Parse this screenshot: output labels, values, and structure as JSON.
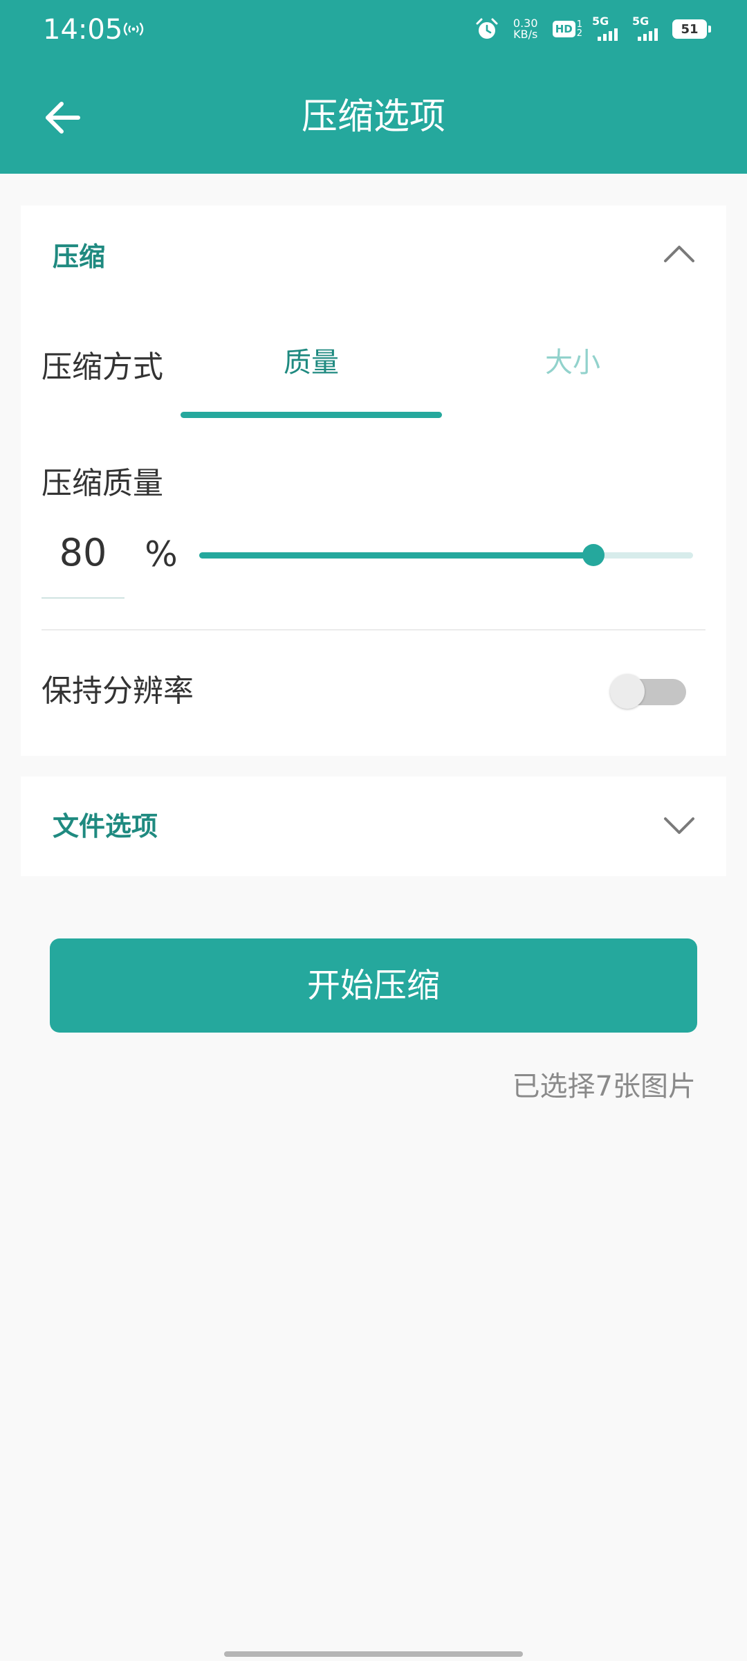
{
  "status_bar": {
    "time": "14:05",
    "hotspot_icon": "hotspot-icon",
    "alarm_icon": "alarm-icon",
    "net_speed_value": "0.30",
    "net_speed_unit": "KB/s",
    "hd_label": "HD",
    "hd_sub_top": "1",
    "hd_sub_bottom": "2",
    "sim1_label": "5G",
    "sim2_label": "5G",
    "battery": "51"
  },
  "app_bar": {
    "back_icon": "arrow-left-icon",
    "title": "压缩选项"
  },
  "compress_section": {
    "header": "压缩",
    "collapse_icon": "chevron-up-icon",
    "method_label": "压缩方式",
    "tabs": [
      {
        "label": "质量",
        "selected": true
      },
      {
        "label": "大小",
        "selected": false
      }
    ],
    "quality_label": "压缩质量",
    "quality_value": "80",
    "quality_unit": "%",
    "slider_fraction": 0.798,
    "keep_resolution_label": "保持分辨率",
    "keep_resolution_on": false
  },
  "file_section": {
    "header": "文件选项",
    "expand_icon": "chevron-down-icon"
  },
  "start_button": "开始压缩",
  "selection_status": "已选择7张图片",
  "colors": {
    "primary": "#25a89d",
    "section_header": "#1f8a80",
    "tab_inactive": "#92d2cc",
    "background": "#f9f9f9"
  }
}
